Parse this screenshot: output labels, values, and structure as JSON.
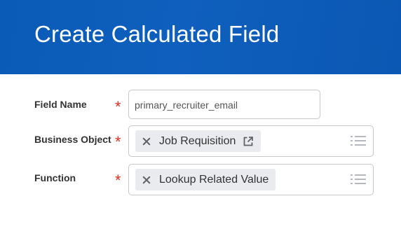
{
  "header": {
    "title": "Create Calculated Field"
  },
  "form": {
    "field_name": {
      "label": "Field Name",
      "required_mark": "*",
      "value": "primary_recruiter_email"
    },
    "business_object": {
      "label": "Business Object",
      "required_mark": "*",
      "pill_label": "Job Requisition",
      "icons": [
        "remove-icon",
        "external-link-icon",
        "list-prompt-icon"
      ]
    },
    "function": {
      "label": "Function",
      "required_mark": "*",
      "pill_label": "Lookup Related Value",
      "icons": [
        "remove-icon",
        "list-prompt-icon"
      ]
    }
  },
  "colors": {
    "header_bg": "#0b5cb8",
    "required": "#de2e21",
    "pill_bg": "#e9ebee"
  }
}
